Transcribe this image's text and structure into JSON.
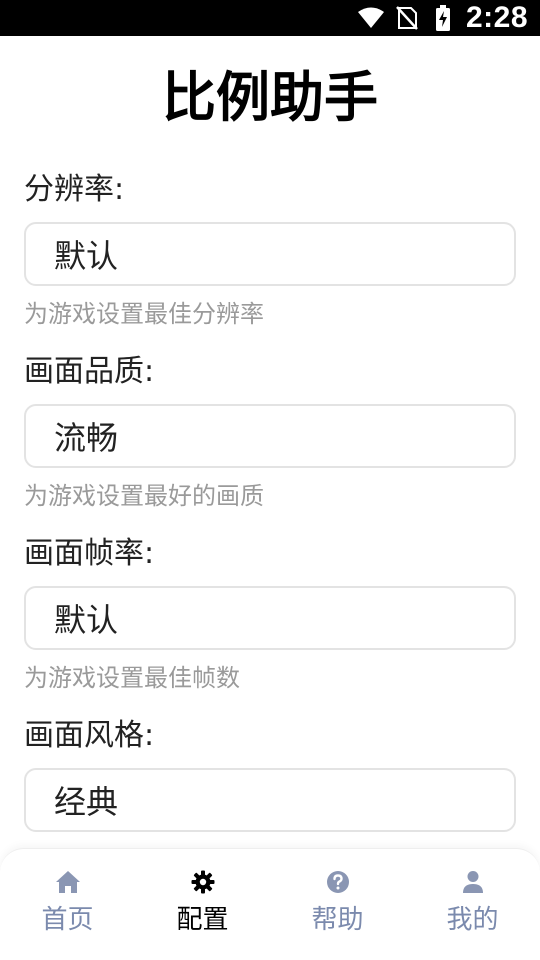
{
  "status_bar": {
    "time": "2:28",
    "icons": [
      "wifi-icon",
      "no-sim-icon",
      "battery-charging-icon"
    ]
  },
  "title": "比例助手",
  "settings": [
    {
      "label": "分辨率:",
      "value": "默认",
      "hint": "为游戏设置最佳分辨率"
    },
    {
      "label": "画面品质:",
      "value": "流畅",
      "hint": "为游戏设置最好的画质"
    },
    {
      "label": "画面帧率:",
      "value": "默认",
      "hint": "为游戏设置最佳帧数"
    },
    {
      "label": "画面风格:",
      "value": "经典",
      "hint": ""
    }
  ],
  "bottom_nav": {
    "active_index": 1,
    "items": [
      {
        "label": "首页",
        "icon": "home-icon"
      },
      {
        "label": "配置",
        "icon": "gear-icon"
      },
      {
        "label": "帮助",
        "icon": "help-icon"
      },
      {
        "label": "我的",
        "icon": "user-icon"
      }
    ]
  },
  "colors": {
    "nav_inactive": "#7b8aad",
    "nav_inactive_icon": "#8a96b3",
    "nav_active": "#000000",
    "hint_text": "#9a9a9a",
    "input_border": "#e3e3e3"
  }
}
